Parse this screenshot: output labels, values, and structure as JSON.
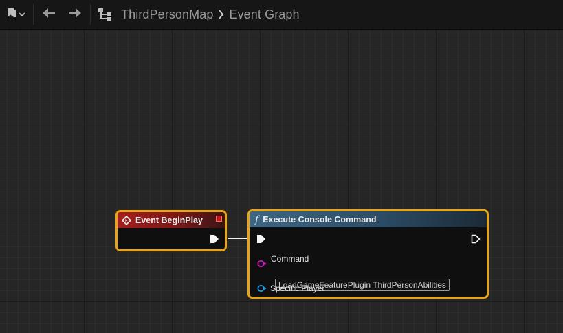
{
  "toolbar": {
    "icons": [
      "bookmark-icon",
      "chevron-down-icon",
      "back-arrow-icon",
      "forward-arrow-icon",
      "graph-icon",
      "breadcrumb-separator-icon"
    ],
    "breadcrumbs": [
      "ThirdPersonMap",
      "Event Graph"
    ]
  },
  "graph": {
    "event_node": {
      "title": "Event BeginPlay",
      "header_color": "#a31d1d",
      "pins": [
        "exec-out"
      ]
    },
    "function_node": {
      "title": "Execute Console Command",
      "header_color": "#3d6784",
      "command_label": "Command",
      "command_value": "LoadGameFeaturePlugin ThirdPersonAbilities",
      "player_label": "Specific Player",
      "command_pin_color": "#d21ac8",
      "player_pin_color": "#1ea3e8"
    },
    "selection_color": "#e6a31c"
  }
}
